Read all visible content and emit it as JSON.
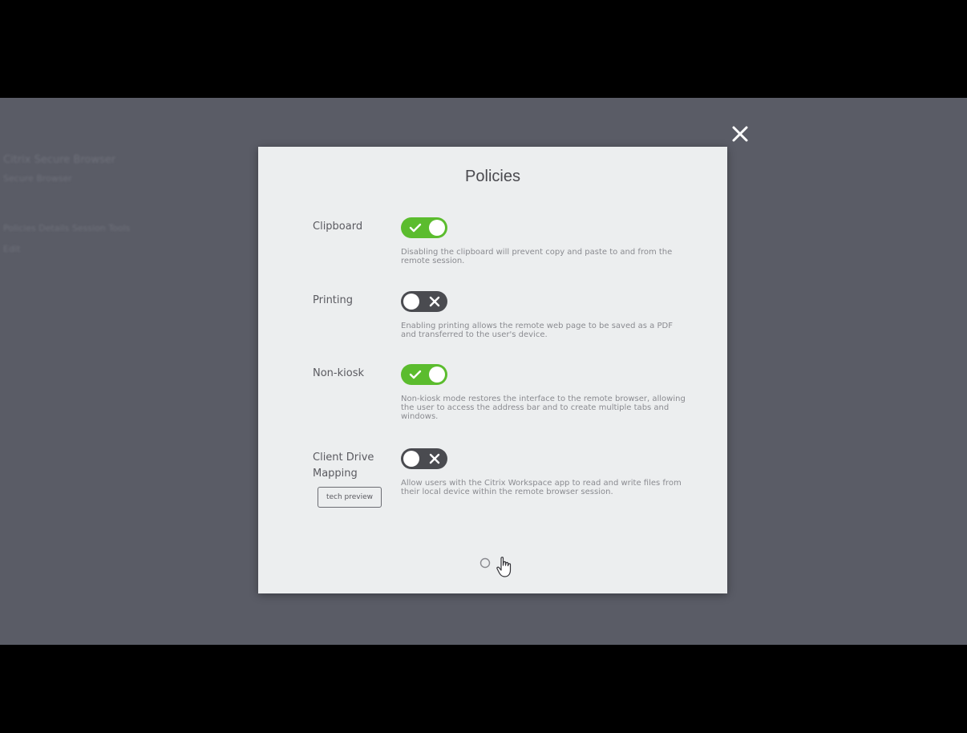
{
  "background": {
    "title": "Citrix Secure Browser",
    "subtitle": "Secure Browser",
    "links": "Policies  Details  Session  Tools",
    "small": "Edit"
  },
  "close_icon": "close-icon",
  "modal": {
    "title": "Policies",
    "policies": [
      {
        "label": "Clipboard",
        "enabled": true,
        "description": "Disabling the clipboard will prevent copy and paste to and from the remote session."
      },
      {
        "label": "Printing",
        "enabled": false,
        "description": "Enabling printing allows the remote web page to be saved as a PDF and transferred to the user's device."
      },
      {
        "label": "Non-kiosk",
        "enabled": true,
        "description": "Non-kiosk mode restores the interface to the remote browser, allowing the user to access the address bar and to create multiple tabs and windows."
      },
      {
        "label": "Client Drive Mapping",
        "enabled": false,
        "badge": "tech preview",
        "description": "Allow users with the Citrix Workspace app to read and write files from their local device within the remote browser session."
      }
    ]
  },
  "colors": {
    "toggle_on": "#5bbc2e",
    "toggle_off": "#4a4b50",
    "modal_bg": "#eceeef",
    "overlay": "#5a5c66"
  }
}
